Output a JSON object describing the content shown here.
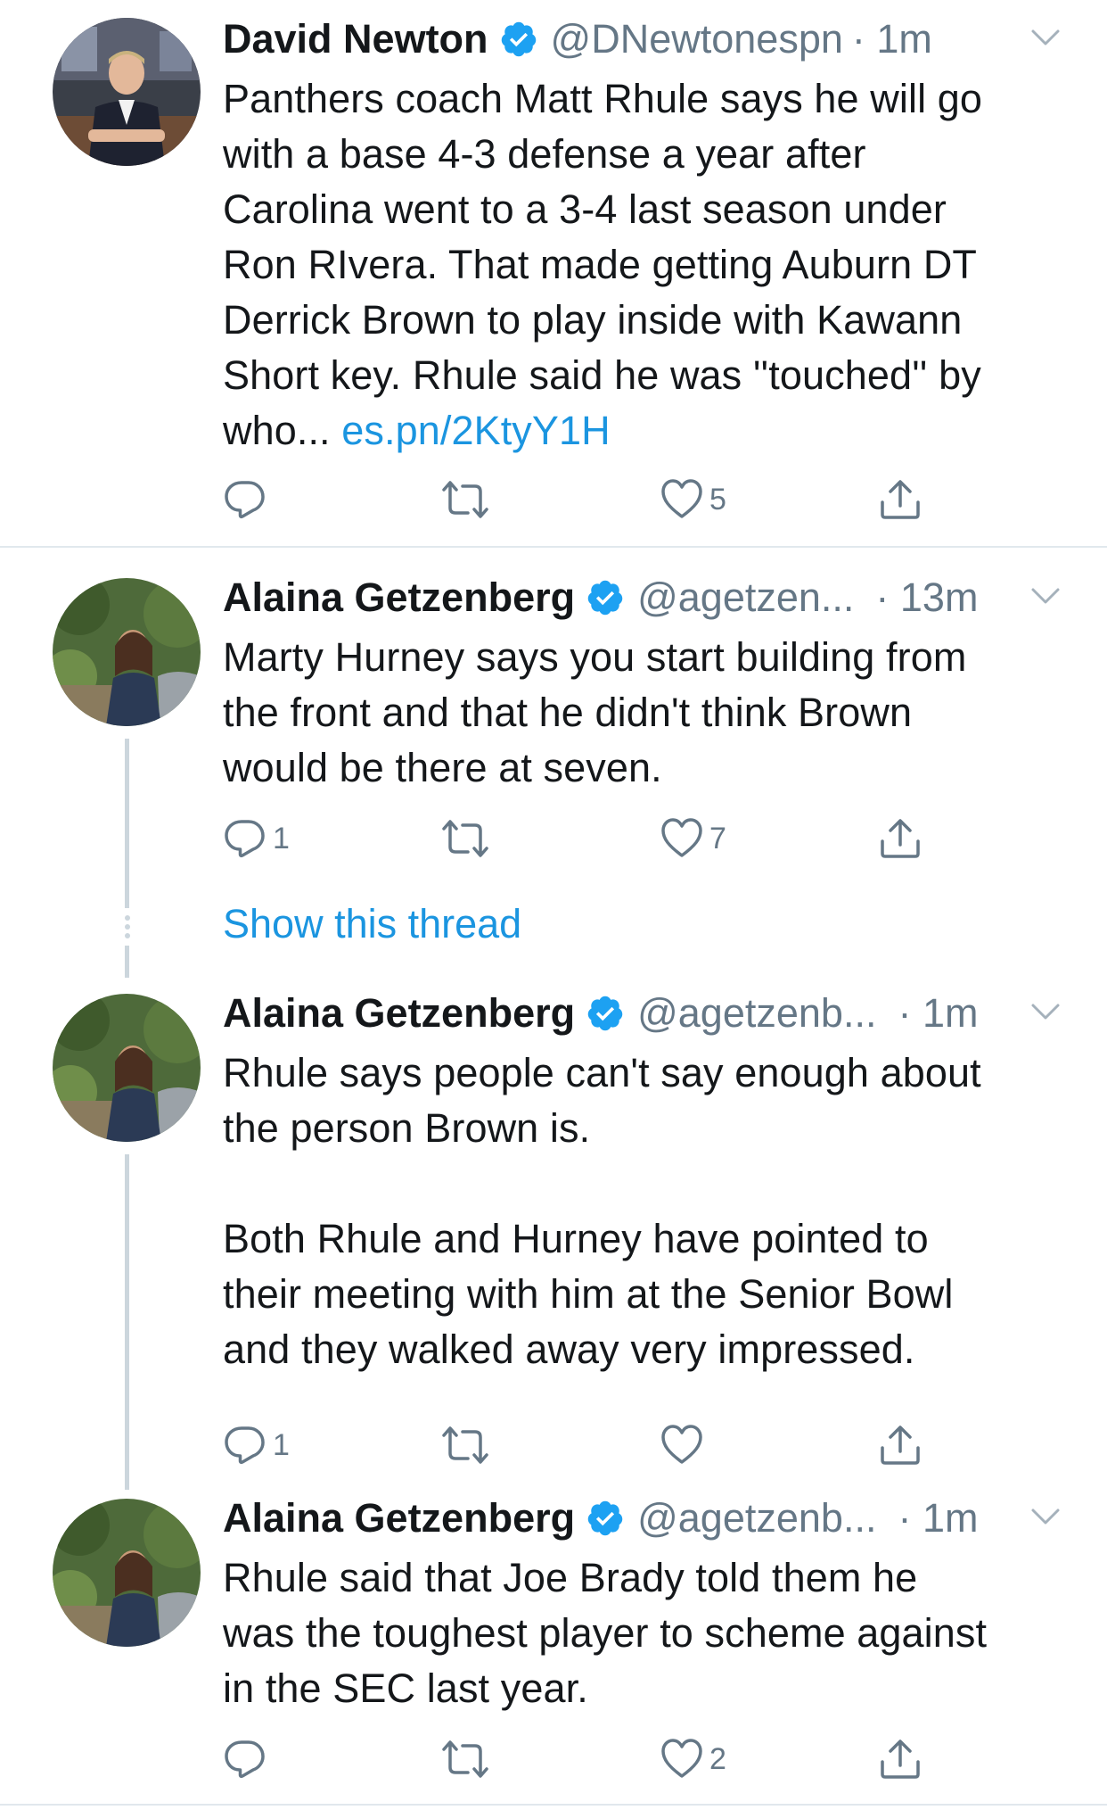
{
  "tweets": [
    {
      "name": "David Newton",
      "handle": "@DNewtonespn",
      "time": "· 1m",
      "text": "Panthers coach Matt Rhule says he will go\nwith a base 4-3 defense a year after\nCarolina went to a 3-4 last season under\nRon RIvera. That made getting Auburn DT\nDerrick Brown to play inside with Kawann\nShort key. Rhule said he was ''touched'' by\nwho... ",
      "link": "es.pn/2KtyY1H",
      "replies": "",
      "retweets": "",
      "likes": "5"
    },
    {
      "name": "Alaina Getzenberg",
      "handle": "@agetzen...",
      "time": "· 13m",
      "text": "Marty Hurney says you start building from\nthe front and that he didn't think Brown\nwould be there at seven.",
      "replies": "1",
      "retweets": "",
      "likes": "7"
    },
    {
      "name": "Alaina Getzenberg",
      "handle": "@agetzenb...",
      "time": "· 1m",
      "text": "Rhule says people can't say enough about\nthe person Brown is.\n\nBoth Rhule and Hurney have pointed to\ntheir meeting with him at the Senior Bowl\nand they walked away very impressed.",
      "replies": "1",
      "retweets": "",
      "likes": ""
    },
    {
      "name": "Alaina Getzenberg",
      "handle": "@agetzenb...",
      "time": "· 1m",
      "text": "Rhule said that Joe Brady told them he\nwas the toughest player to scheme against\nin the SEC last year.",
      "replies": "",
      "retweets": "",
      "likes": "2"
    }
  ],
  "show_thread": "Show this thread",
  "colors": {
    "link": "#1b95e0",
    "verified": "#1da1f2",
    "secondary_text": "#657786",
    "thread_line": "#ccd6dd"
  },
  "icons": [
    "verified-badge-icon",
    "chevron-down-icon",
    "reply-icon",
    "retweet-icon",
    "like-icon",
    "share-icon"
  ]
}
